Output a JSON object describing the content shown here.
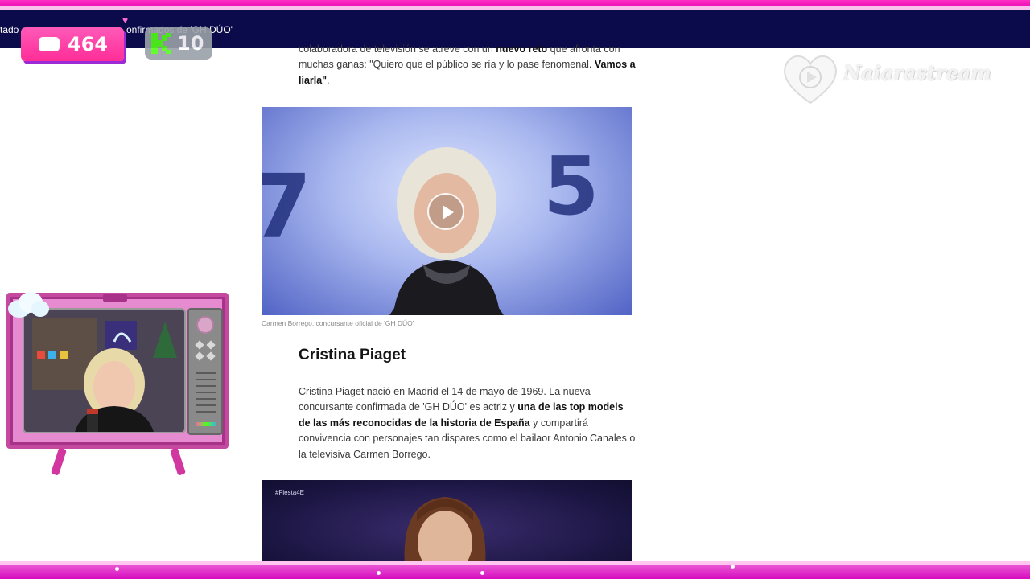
{
  "browser": {
    "tab_title_left": "tado c",
    "tab_title_right": "onfirmados de 'GH DÚO'"
  },
  "overlay": {
    "youtube_viewers": "464",
    "kick_viewers": "10",
    "youtube_icon": "youtube-icon",
    "kick_icon": "kick-icon",
    "heart_icon": "heart-icon",
    "watermark_text": "Naiarastream",
    "colors": {
      "frame_pink": "#e000b0",
      "nav_navy": "#0b0a4a",
      "kick_green": "#53fc18",
      "youtube_pink": "#ff2d98"
    }
  },
  "article": {
    "intro": {
      "t1": "colaboradora de televisión se atreve con un ",
      "b1": "nuevo reto",
      "t2": " que afronta con muchas ganas: \"Quiero que el público se ría y lo pase fenomenal. ",
      "b2": "Vamos a liarla\"",
      "t3": "."
    },
    "video1": {
      "digit_left": "7",
      "digit_right": "5",
      "play_icon": "play-icon"
    },
    "caption": "Carmen Borrego, concursante oficial de 'GH DÚO'",
    "section_heading": "Cristina Piaget",
    "body": {
      "t1": "Cristina Piaget nació en Madrid el 14 de mayo de 1969. La nueva concursante confirmada de 'GH DÚO' es actriz y ",
      "b1": "una de las top models de las más reconocidas de la historia de España",
      "t2": " y compartirá convivencia con personajes tan dispares como el bailaor Antonio Canales o la televisiva Carmen Borrego."
    },
    "video2": {
      "hashtag": "#Fiesta4E"
    }
  }
}
